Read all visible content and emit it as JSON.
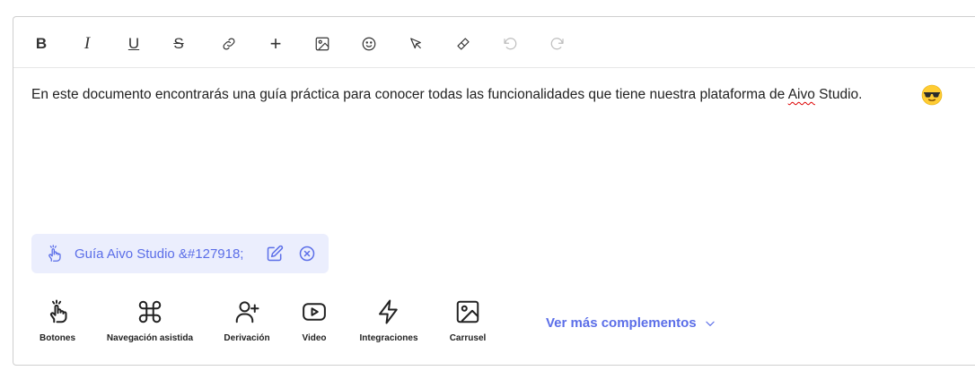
{
  "toolbar": {
    "bold": "B",
    "italic": "I",
    "underline": "U",
    "strike": "S",
    "plus": "+"
  },
  "content": {
    "text_before": "En este documento encontrarás una guía práctica para conocer todas las funcionalidades que tiene nuestra plataforma de ",
    "misspelled": "Aivo",
    "text_after": " Studio."
  },
  "chip": {
    "label": "Guía Aivo Studio &#127918;"
  },
  "tools": [
    {
      "label": "Botones",
      "icon": "tap-hand-icon"
    },
    {
      "label": "Navegación asistida",
      "icon": "command-icon"
    },
    {
      "label": "Derivación",
      "icon": "user-plus-icon"
    },
    {
      "label": "Video",
      "icon": "play-icon"
    },
    {
      "label": "Integraciones",
      "icon": "lightning-icon"
    },
    {
      "label": "Carrusel",
      "icon": "image-icon"
    }
  ],
  "more": {
    "label": "Ver más complementos"
  },
  "colors": {
    "accent": "#5b6ee8",
    "chip_bg": "#ebeefd"
  }
}
